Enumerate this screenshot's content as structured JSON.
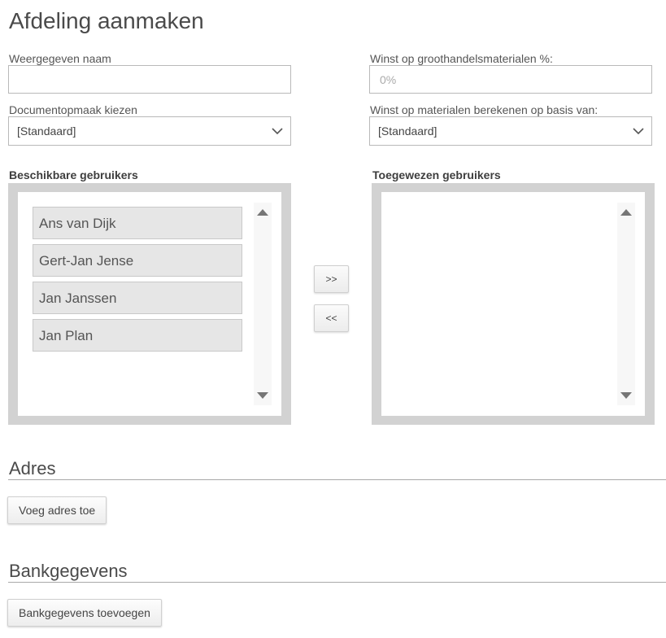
{
  "page": {
    "title": "Afdeling aanmaken"
  },
  "form": {
    "name_label": "Weergegeven naam",
    "name_value": "",
    "wholesale_label": "Winst op groothandelsmaterialen %:",
    "wholesale_placeholder": "0%",
    "doc_layout_label": "Documentopmaak kiezen",
    "doc_layout_value": "[Standaard]",
    "profit_basis_label": "Winst op materialen berekenen op basis van:",
    "profit_basis_value": "[Standaard]"
  },
  "users": {
    "available_label": "Beschikbare gebruikers",
    "assigned_label": "Toegewezen gebruikers",
    "available": [
      "Ans van Dijk",
      "Gert-Jan Jense",
      "Jan Janssen",
      "Jan Plan"
    ],
    "assigned": [],
    "add_button": ">>",
    "remove_button": "<<"
  },
  "address": {
    "heading": "Adres",
    "add_button": "Voeg adres toe"
  },
  "bank": {
    "heading": "Bankgegevens",
    "add_button": "Bankgegevens toevoegen"
  },
  "icons": {
    "select_chevron": "chevron-down-icon",
    "scroll_up": "scroll-up-icon",
    "scroll_down": "scroll-down-icon"
  }
}
